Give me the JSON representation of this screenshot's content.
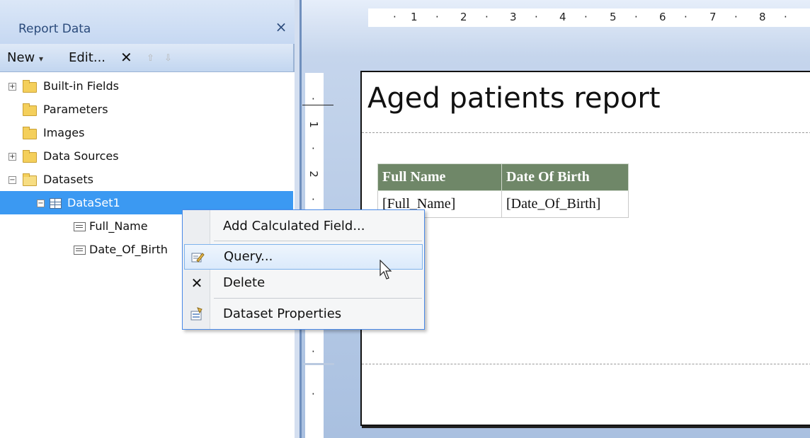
{
  "pane": {
    "title": "Report Data",
    "close_glyph": "×",
    "toolbar": {
      "new_label": "New",
      "new_arrow": "▾",
      "edit_label": "Edit...",
      "delete_glyph": "✕",
      "move_up_glyph": "⇧",
      "move_down_glyph": "⇩"
    },
    "tree": [
      {
        "label": "Built-in Fields",
        "expander": "+",
        "icon": "folder-icon"
      },
      {
        "label": "Parameters",
        "expander": "",
        "icon": "folder-icon"
      },
      {
        "label": "Images",
        "expander": "",
        "icon": "folder-icon"
      },
      {
        "label": "Data Sources",
        "expander": "+",
        "icon": "folder-icon"
      },
      {
        "label": "Datasets",
        "expander": "−",
        "icon": "open-folder-icon"
      },
      {
        "label": "DataSet1",
        "expander": "−",
        "icon": "dataset-icon",
        "selected": true
      },
      {
        "label": "Full_Name",
        "icon": "field-icon"
      },
      {
        "label": "Date_Of_Birth",
        "icon": "field-icon"
      }
    ]
  },
  "ruler": {
    "horizontal": [
      "1",
      "2",
      "3",
      "4",
      "5",
      "6",
      "7",
      "8"
    ],
    "vertical": [
      "1",
      "2"
    ]
  },
  "report": {
    "title": "Aged patients report",
    "table": {
      "headers": [
        "Full Name",
        "Date Of Birth"
      ],
      "row": [
        "[Full_Name]",
        "[Date_Of_Birth]"
      ]
    }
  },
  "context_menu": {
    "items": [
      {
        "label": "Add Calculated Field...",
        "icon": ""
      },
      {
        "label": "Query...",
        "icon": "query-icon",
        "highlighted": true
      },
      {
        "label": "Delete",
        "icon": "delete-icon"
      },
      {
        "label": "Dataset Properties",
        "icon": "properties-icon"
      }
    ]
  },
  "colors": {
    "selection": "#3b99f2",
    "table_header": "#6f8768",
    "menu_border": "#4a8ae8"
  }
}
